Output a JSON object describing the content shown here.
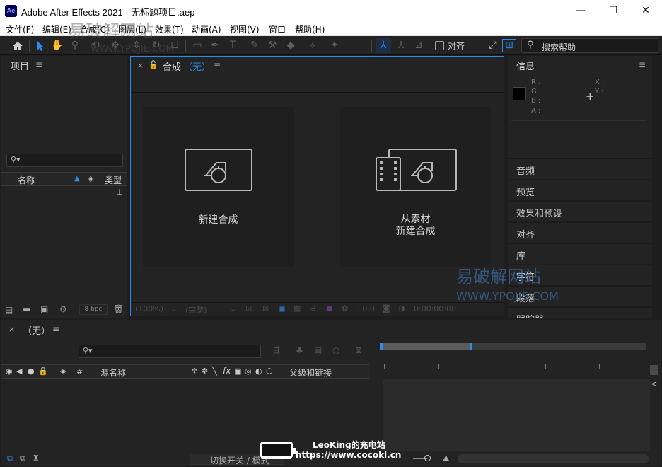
{
  "window": {
    "app_badge": "Ae",
    "title": "Adobe After Effects 2021 - 无标题项目.aep",
    "minimize": "—",
    "maximize": "☐",
    "close": "✕"
  },
  "menu": [
    "文件(F)",
    "编辑(E)",
    "合成(C)",
    "图层(L)",
    "效果(T)",
    "动画(A)",
    "视图(V)",
    "窗口",
    "帮助(H)"
  ],
  "toolbar": {
    "snap_label": "对齐",
    "search_label": "搜索帮助"
  },
  "project": {
    "title": "项目",
    "search_icon_text": "⚲▾",
    "col_name": "名称",
    "col_type": "类型",
    "bpc": "8 bpc"
  },
  "composition": {
    "tab_label": "合成",
    "tab_value": "（无）",
    "new_comp": "新建合成",
    "from_footage_line1": "从素材",
    "from_footage_line2": "新建合成",
    "zoom": "(100%)",
    "quality": "(完整)",
    "exposure": "+0.0",
    "timecode": "0:00:00:00"
  },
  "info": {
    "title": "信息",
    "r": "R :",
    "g": "G :",
    "b": "B :",
    "a": "A :",
    "x": "X :",
    "y": "Y :"
  },
  "side_panels": [
    "音频",
    "预览",
    "效果和预设",
    "对齐",
    "库",
    "字符",
    "段落",
    "跟踪器"
  ],
  "timeline": {
    "tab_label": "（无）",
    "col_hash": "#",
    "col_source": "源名称",
    "col_parent": "父级和链接",
    "toggle_label": "切换开关 / 模式"
  },
  "watermarks": {
    "top": "易破解网站",
    "top_url": "WWW.YPOJIE.COM",
    "mid": "易破解网站",
    "mid_url": "WWW.YPOJIE.COM"
  },
  "badge": {
    "line1": "LeoKing的充电站",
    "line2": "https://www.cocokl.cn"
  }
}
